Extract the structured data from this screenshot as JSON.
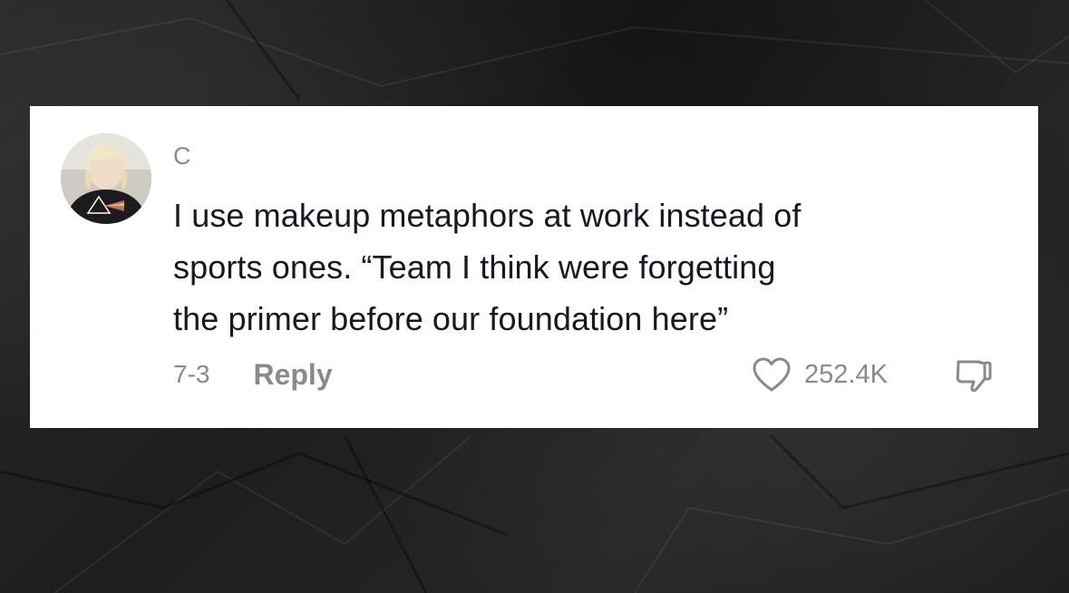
{
  "comment": {
    "username": "C",
    "text": "I use makeup metaphors at work instead of\nsports ones. “Team I think were forgetting\nthe primer before our foundation here”",
    "date": "7-3",
    "reply_label": "Reply",
    "like_count": "252.4K"
  },
  "icons": {
    "like": "heart-outline-icon",
    "dislike": "thumbs-down-outline-icon"
  },
  "colors": {
    "background": "#222222",
    "card": "#ffffff",
    "text": "#161823",
    "muted": "#8a8a8a"
  }
}
